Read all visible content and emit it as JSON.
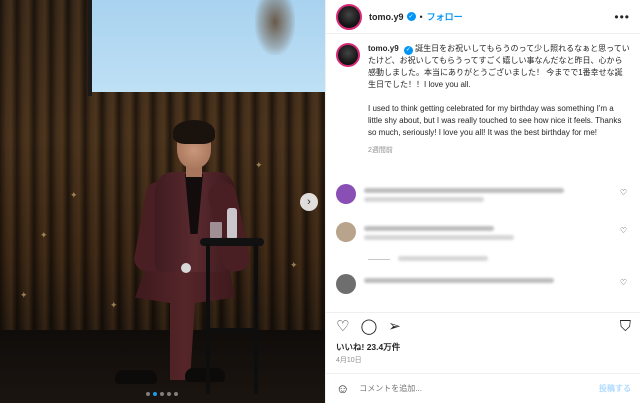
{
  "post": {
    "username": "tomo.y9",
    "separator": "•",
    "follow_label": "フォロー",
    "more_label": "•••",
    "caption_jp": "誕生日をお祝いしてもらうのって少し照れるなぁと思っていたけど、お祝いしてもらうってすごく嬉しい事なんだなと昨日、心から感動しました。本当にありがとうございました！ 今までで1番幸せな誕生日でした！！I love you all.",
    "caption_en": "I used to think getting celebrated for my birthday was something I'm a little shy about, but I was really touched to see how nice it feels. Thanks so much, seriously! I love you all! It was the best birthday for me!",
    "time_ago": "2週間前",
    "likes": "いいね! 23.4万件",
    "date": "4月10日"
  },
  "comments": [
    {
      "avatar_color": "#8a4fb5"
    },
    {
      "avatar_color": "#b8a38c"
    },
    {
      "avatar_color": "#6e6e6e"
    }
  ],
  "icons": {
    "verified": "✓",
    "carousel_next": "›",
    "like": "♡",
    "comment": "◯",
    "share": "➢",
    "save": "⛉",
    "emoji": "☺"
  },
  "composer": {
    "placeholder": "コメントを追加...",
    "post_label": "投稿する"
  },
  "carousel": {
    "total": 5,
    "current": 2
  }
}
